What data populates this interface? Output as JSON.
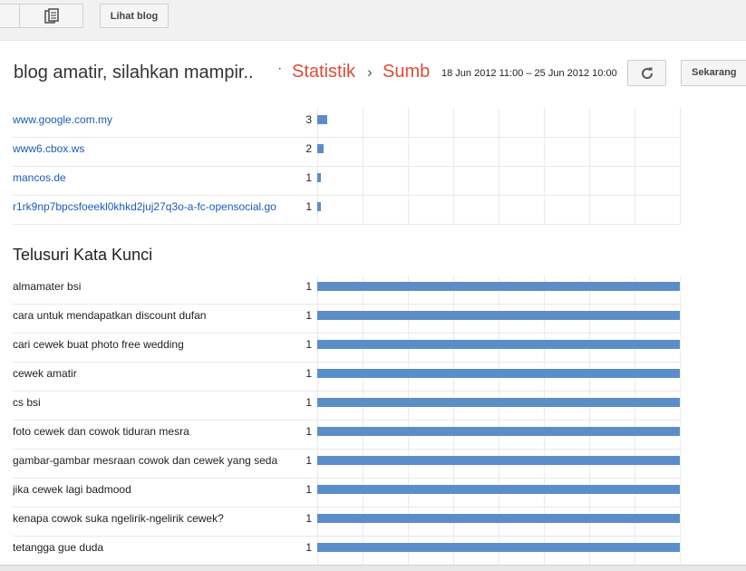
{
  "toolbar": {
    "view_blog_label": "Lihat blog"
  },
  "header": {
    "blog_title": "blog amatir, silahkan mampir..",
    "separator": "·",
    "crumbs": [
      "Statistik",
      "Sumb"
    ],
    "crumb_arrow": "›",
    "date_range": "18 Jun 2012 11:00 – 25 Jun 2012 10:00",
    "now_label": "Sekarang"
  },
  "referrers": [
    {
      "label": "www.google.com.my",
      "count": "3",
      "value": 3
    },
    {
      "label": "www6.cbox.ws",
      "count": "2",
      "value": 2
    },
    {
      "label": "mancos.de",
      "count": "1",
      "value": 1
    },
    {
      "label": "r1rk9np7bpcsfoeekl0khkd2juj27q3o-a-fc-opensocial.go",
      "count": "1",
      "value": 1
    }
  ],
  "keywords_section": {
    "title": "Telusuri Kata Kunci",
    "rows": [
      {
        "label": "almamater bsi",
        "count": "1",
        "value": 1
      },
      {
        "label": "cara untuk mendapatkan discount dufan",
        "count": "1",
        "value": 1
      },
      {
        "label": "cari cewek buat photo free wedding",
        "count": "1",
        "value": 1
      },
      {
        "label": "cewek amatir",
        "count": "1",
        "value": 1
      },
      {
        "label": "cs bsi",
        "count": "1",
        "value": 1
      },
      {
        "label": "foto cewek dan cowok tiduran mesra",
        "count": "1",
        "value": 1
      },
      {
        "label": "gambar-gambar mesraan cowok dan cewek yang seda",
        "count": "1",
        "value": 1
      },
      {
        "label": "jika cewek lagi badmood",
        "count": "1",
        "value": 1
      },
      {
        "label": "kenapa cowok suka ngelirik-ngelirik cewek?",
        "count": "1",
        "value": 1
      },
      {
        "label": "tetangga gue duda",
        "count": "1",
        "value": 1
      }
    ]
  },
  "colors": {
    "bar": "#5b8ec8",
    "link": "#1a5bb8",
    "crumb": "#dd4b39"
  }
}
